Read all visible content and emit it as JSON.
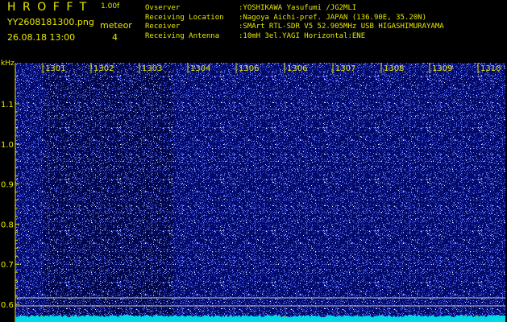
{
  "header": {
    "app_title": "HROFFT",
    "app_version": "1.00f",
    "file_name": "YY2608181300.png",
    "date_time": "26.08.18 13:00",
    "meteor_label": "meteor",
    "meteor_count": "4"
  },
  "info": [
    {
      "key": "Ovserver",
      "value": ":YOSHIKAWA Yasufumi /JG2MLI"
    },
    {
      "key": "Receiving Location",
      "value": ":Nagoya Aichi-pref. JAPAN (136.90E, 35.20N)"
    },
    {
      "key": "Receiver",
      "value": ":SMArt RTL-SDR V5 52.905MHz USB HIGASHIMURAYAMA"
    },
    {
      "key": "Receiving Antenna",
      "value": ":10mH 3el.YAGI Horizontal:ENE"
    }
  ],
  "spectrogram": {
    "y_axis_unit": "kHz",
    "y_ticks": [
      "1.1",
      "1.0",
      "0.9",
      "0.8",
      "0.7",
      "0.6"
    ],
    "x_ticks": [
      "1301",
      "1302",
      "1303",
      "1304",
      "1306",
      "1306",
      "1307",
      "1308",
      "1309",
      "1310"
    ],
    "colors": {
      "text": "#e8e800",
      "background": "#020a6a",
      "dark_band": "#010533",
      "noise": "#6f7fff",
      "marker_line": "#c8c8c8",
      "baseline": "#00d8e8"
    }
  }
}
